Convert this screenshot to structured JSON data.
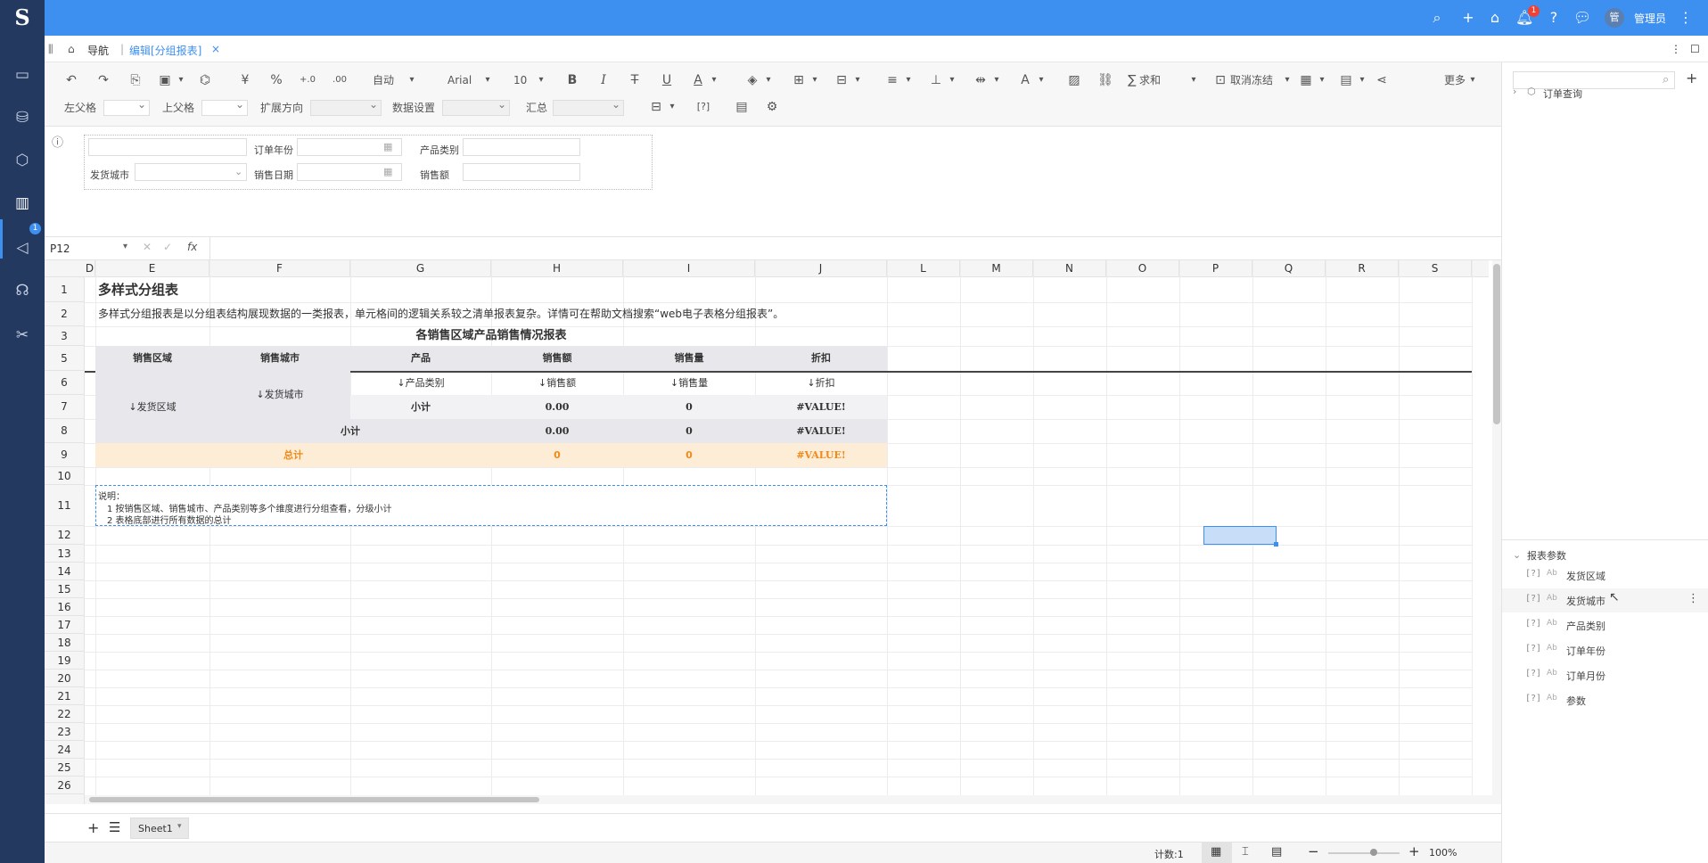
{
  "app": {
    "logo": "S",
    "admin_label": "管理员",
    "avatar_text": "管",
    "notif_count": "1",
    "nav_badge": "1"
  },
  "tabs": {
    "nav_label": "导航",
    "edit_tab": "编辑[分组报表]",
    "close": "×"
  },
  "toolbar": {
    "format": "自动",
    "font": "Arial",
    "size": "10",
    "sum": "求和",
    "freeze": "取消冻结",
    "more": "更多",
    "left_parent": "左父格",
    "top_parent": "上父格",
    "expand": "扩展方向",
    "data_setting": "数据设置",
    "summary": "汇总",
    "yen": "¥",
    "percent": "%"
  },
  "params": {
    "order_year": "订单年份",
    "product_category": "产品类别",
    "ship_city": "发货城市",
    "sales_date": "销售日期",
    "sales_amount": "销售额"
  },
  "formula": {
    "cell_ref": "P12",
    "fx": "fx"
  },
  "columns": [
    "D",
    "E",
    "F",
    "G",
    "H",
    "I",
    "J",
    "L",
    "M",
    "N",
    "O",
    "P",
    "Q",
    "R",
    "S"
  ],
  "rows": [
    "1",
    "2",
    "3",
    "5",
    "6",
    "7",
    "8",
    "9",
    "10",
    "11",
    "12",
    "13",
    "14",
    "15",
    "16",
    "17",
    "18",
    "19",
    "20",
    "21",
    "22",
    "23",
    "24",
    "25",
    "26"
  ],
  "report": {
    "title": "多样式分组表",
    "desc": "多样式分组报表是以分组表结构展现数据的一类报表，单元格间的逻辑关系较之清单报表复杂。详情可在帮助文档搜索“web电子表格分组报表”。",
    "table_title": "各销售区域产品销售情况报表",
    "headers": [
      "销售区域",
      "销售城市",
      "产品",
      "销售额",
      "销售量",
      "折扣"
    ],
    "row6": [
      "↓产品类别",
      "↓销售额",
      "↓销售量",
      "↓折扣"
    ],
    "region": "↓发货区域",
    "city": "↓发货城市",
    "row7": [
      "小计",
      "0.00",
      "0",
      "#VALUE!"
    ],
    "row8": [
      "小计",
      "0.00",
      "0",
      "#VALUE!"
    ],
    "row9": [
      "总计",
      "0",
      "0",
      "#VALUE!"
    ],
    "note_title": "说明：",
    "note1": "1  按销售区域、销售城市、产品类别等多个维度进行分组查看，分级小计",
    "note2": "2  表格底部进行所有数据的总计"
  },
  "sheet": {
    "name": "Sheet1"
  },
  "status": {
    "count": "计数:1",
    "zoom": "100%"
  },
  "right": {
    "tree_item": "订单查询",
    "params_title": "报表参数",
    "param_items": [
      "发货区域",
      "发货城市",
      "产品类别",
      "订单年份",
      "订单月份",
      "参数"
    ],
    "param_prefix": "[?]",
    "param_type": "Ab"
  }
}
